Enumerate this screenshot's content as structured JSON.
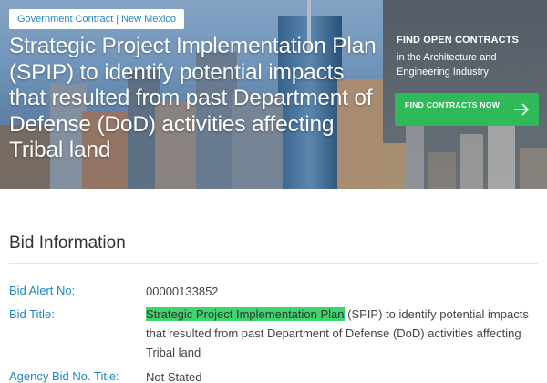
{
  "hero": {
    "tag": "Government Contract | New Mexico",
    "title": "Strategic Project Implementation Plan (SPIP) to identify potential impacts that resulted from past Department of Defense (DoD) activities affecting Tribal land"
  },
  "panel": {
    "title": "FIND OPEN CONTRACTS",
    "subtitle": "in the Architecture and Engineering Industry",
    "cta_label": "FIND CONTRACTS NOW",
    "cta_icon": "arrow-right-icon"
  },
  "section": {
    "title": "Bid Information"
  },
  "rows": [
    {
      "label": "Bid Alert No:",
      "value": "00000133852"
    },
    {
      "label": "Bid Title:",
      "highlight": "Strategic Project Implementation Plan",
      "value": " (SPIP) to identify potential impacts that resulted from past Department of Defense (DoD) activities affecting Tribal land"
    },
    {
      "label": "Agency Bid No. Title:",
      "value": "Not Stated"
    }
  ],
  "colors": {
    "accent": "#1e88c7",
    "cta": "#2fba5a",
    "highlight": "#3dd56d"
  }
}
